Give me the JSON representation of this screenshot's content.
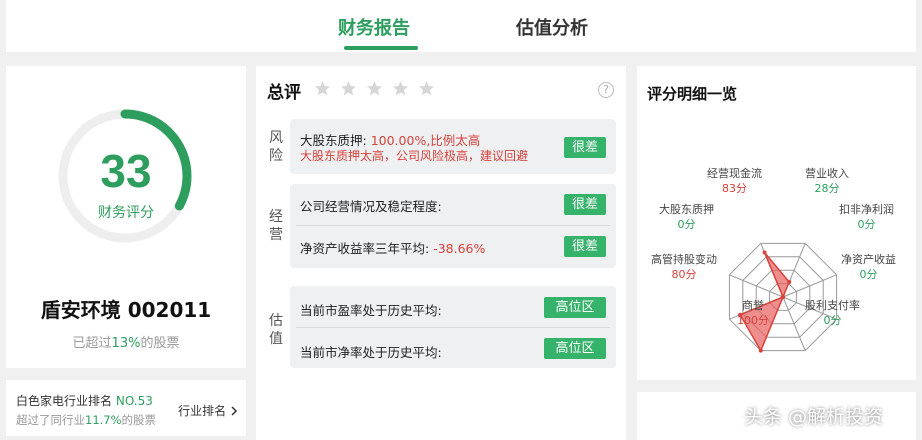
{
  "tabs": [
    {
      "label": "财务报告",
      "active": true
    },
    {
      "label": "估值分析",
      "active": false
    }
  ],
  "score": {
    "value": "33",
    "label": "财务评分",
    "ring_fraction": 0.33,
    "company": "盾安环境 002011",
    "beat_prefix": "已超过",
    "beat_percent": "13%",
    "beat_suffix": "的股票"
  },
  "rank": {
    "prefix": "白色家电行业排名",
    "no": "NO.53",
    "beat_prefix": "超过了同行业",
    "beat_percent": "11.7%",
    "beat_suffix": "的股票",
    "button": "行业排名"
  },
  "overview": {
    "title": "总评",
    "stars_filled": 0,
    "stars_total": 5,
    "help_icon": "?",
    "sections": {
      "risk": {
        "label": "风险",
        "item": {
          "name": "大股东质押:",
          "value": "100.00%,比例太高",
          "note": "大股东质押太高，公司风险极高，建议回避",
          "badge": "很差"
        }
      },
      "operation": {
        "label": "经营",
        "items": [
          {
            "name": "公司经营情况及稳定程度:",
            "value": "",
            "badge": "很差"
          },
          {
            "name": "净资产收益率三年平均:",
            "value": "-38.66%",
            "badge": "很差"
          }
        ]
      },
      "valuation": {
        "label": "估值",
        "items": [
          {
            "name": "当前市盈率处于历史平均:",
            "badge": "高位区"
          },
          {
            "name": "当前市净率处于历史平均:",
            "badge": "高位区"
          }
        ]
      }
    }
  },
  "radar": {
    "title": "评分明细一览",
    "labels": [
      {
        "name": "营业收入",
        "value": "28分"
      },
      {
        "name": "扣非净利润",
        "value": "0分"
      },
      {
        "name": "净资产收益",
        "value": "0分"
      },
      {
        "name": "股利支付率",
        "value": "0分"
      },
      {
        "name": "商誉",
        "value": "100分"
      },
      {
        "name": "高管持股变动",
        "value": "80分"
      },
      {
        "name": "大股东质押",
        "value": "0分"
      },
      {
        "name": "经营现金流",
        "value": "83分"
      }
    ],
    "values": [
      28,
      0,
      0,
      0,
      100,
      80,
      0,
      83
    ],
    "max": 100
  },
  "watermark": "头条 @解析投资",
  "colors": {
    "accent": "#2e9e5e",
    "badge": "#36b36b",
    "danger": "#d9413b",
    "radar_fill": "#e8605c"
  }
}
